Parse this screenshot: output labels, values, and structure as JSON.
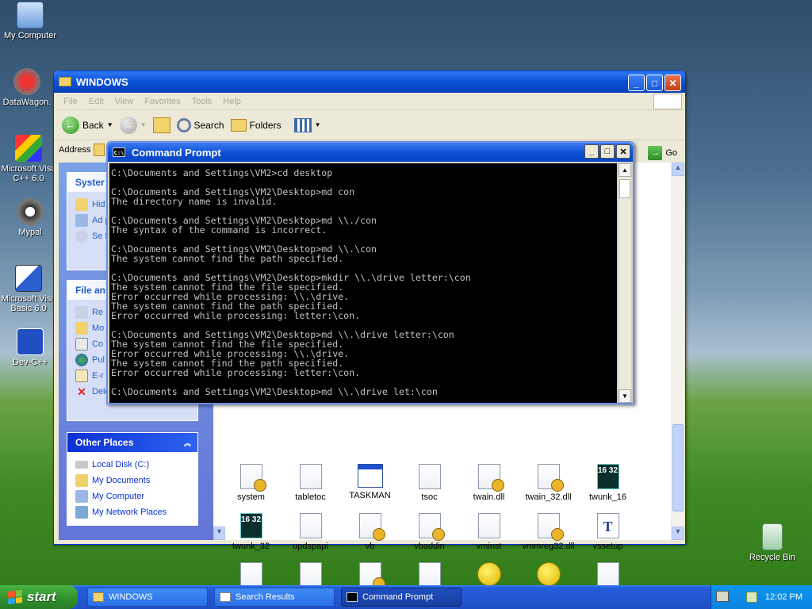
{
  "desktop": {
    "icons": [
      {
        "label": "My Computer"
      },
      {
        "label": "DataWagon."
      },
      {
        "label": "Microsoft Visu C++ 6.0"
      },
      {
        "label": "Mypal"
      },
      {
        "label": "Microsoft Visu Basic 6.0"
      },
      {
        "label": "Dev-C++"
      },
      {
        "label": "Recycle Bin"
      }
    ]
  },
  "explorer": {
    "title": "WINDOWS",
    "menu": [
      "File",
      "Edit",
      "View",
      "Favorites",
      "Tools",
      "Help"
    ],
    "toolbar": {
      "back": "Back",
      "search": "Search",
      "folders": "Folders"
    },
    "address_label": "Address",
    "go_label": "Go",
    "system_tasks": {
      "header": "Syster",
      "items": [
        "Hid this",
        "Ad pro",
        "Se fol"
      ]
    },
    "file_tasks": {
      "header": "File an",
      "items": [
        "Re",
        "Mo",
        "Co",
        "Pul We",
        "E-r",
        "Delete this file"
      ]
    },
    "other_places": {
      "header": "Other Places",
      "items": [
        "Local Disk (C:)",
        "My Documents",
        "My Computer",
        "My Network Places"
      ]
    },
    "files": [
      {
        "name": "system",
        "kind": "gear"
      },
      {
        "name": "tabletoc",
        "kind": "doc"
      },
      {
        "name": "TASKMAN",
        "kind": "app"
      },
      {
        "name": "tsoc",
        "kind": "doc"
      },
      {
        "name": "twain.dll",
        "kind": "gear"
      },
      {
        "name": "twain_32.dll",
        "kind": "gear"
      },
      {
        "name": "twunk_16",
        "kind": "dark"
      },
      {
        "name": "twunk_32",
        "kind": "dark"
      },
      {
        "name": "updspapi",
        "kind": "doc"
      },
      {
        "name": "vb",
        "kind": "gear"
      },
      {
        "name": "vbaddin",
        "kind": "gear"
      },
      {
        "name": "vminst",
        "kind": "doc"
      },
      {
        "name": "vmmreg32.dll",
        "kind": "gear"
      },
      {
        "name": "vssetup",
        "kind": "font"
      },
      {
        "name": "",
        "kind": "doc"
      },
      {
        "name": "",
        "kind": "doc"
      },
      {
        "name": "",
        "kind": "gear"
      },
      {
        "name": "",
        "kind": "doc"
      },
      {
        "name": "",
        "kind": "help"
      },
      {
        "name": "",
        "kind": "help"
      },
      {
        "name": "",
        "kind": "doc"
      }
    ],
    "twunk_icon_text": "16 32"
  },
  "cmd": {
    "title": "Command Prompt",
    "icon_text": "C:\\",
    "lines": [
      "C:\\Documents and Settings\\VM2>cd desktop",
      "",
      "C:\\Documents and Settings\\VM2\\Desktop>md con",
      "The directory name is invalid.",
      "",
      "C:\\Documents and Settings\\VM2\\Desktop>md \\\\./con",
      "The syntax of the command is incorrect.",
      "",
      "C:\\Documents and Settings\\VM2\\Desktop>md \\\\.\\con",
      "The system cannot find the path specified.",
      "",
      "C:\\Documents and Settings\\VM2\\Desktop>mkdir \\\\.\\drive letter:\\con",
      "The system cannot find the file specified.",
      "Error occurred while processing: \\\\.\\drive.",
      "The system cannot find the path specified.",
      "Error occurred while processing: letter:\\con.",
      "",
      "C:\\Documents and Settings\\VM2\\Desktop>md \\\\.\\drive letter:\\con",
      "The system cannot find the file specified.",
      "Error occurred while processing: \\\\.\\drive.",
      "The system cannot find the path specified.",
      "Error occurred while processing: letter:\\con.",
      "",
      "C:\\Documents and Settings\\VM2\\Desktop>md \\\\.\\drive let:\\con"
    ]
  },
  "taskbar": {
    "start": "start",
    "buttons": [
      "WINDOWS",
      "Search Results",
      "Command Prompt"
    ],
    "active_index": 2,
    "clock": "12:02 PM"
  }
}
